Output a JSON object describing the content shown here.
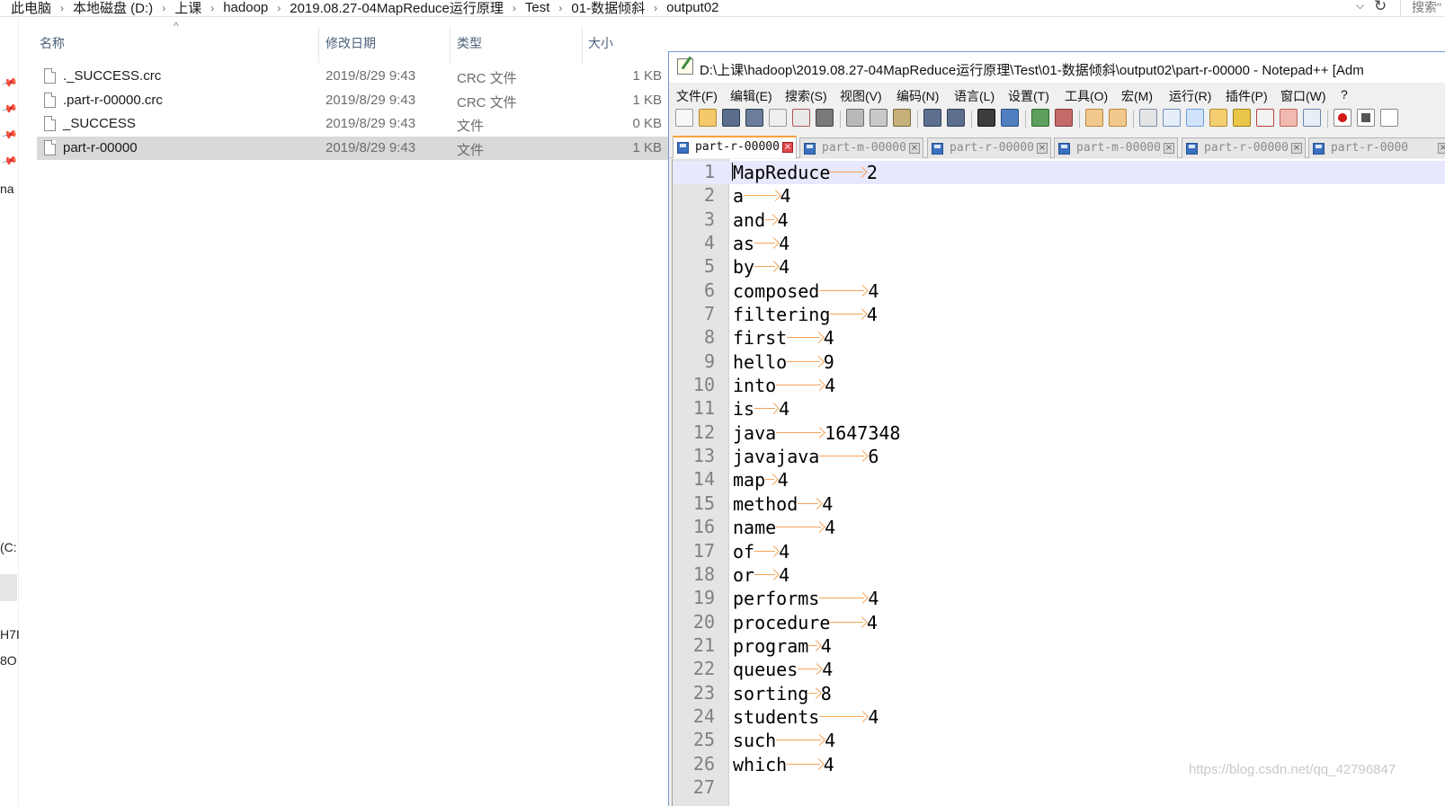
{
  "explorer": {
    "breadcrumbs": [
      "此电脑",
      "本地磁盘 (D:)",
      "上课",
      "hadoop",
      "2019.08.27-04MapReduce运行原理",
      "Test",
      "01-数据倾斜",
      "output02"
    ],
    "search_placeholder": "搜索\"",
    "nav_fragments": [
      "na",
      "(C:",
      "H7I",
      "8O"
    ],
    "columns": {
      "name": "名称",
      "date": "修改日期",
      "type": "类型",
      "size": "大小"
    },
    "files": [
      {
        "name": "._SUCCESS.crc",
        "date": "2019/8/29 9:43",
        "type": "CRC 文件",
        "size": "1 KB",
        "selected": false
      },
      {
        "name": ".part-r-00000.crc",
        "date": "2019/8/29 9:43",
        "type": "CRC 文件",
        "size": "1 KB",
        "selected": false
      },
      {
        "name": "_SUCCESS",
        "date": "2019/8/29 9:43",
        "type": "文件",
        "size": "0 KB",
        "selected": false
      },
      {
        "name": "part-r-00000",
        "date": "2019/8/29 9:43",
        "type": "文件",
        "size": "1 KB",
        "selected": true
      }
    ]
  },
  "notepad": {
    "title": "D:\\上课\\hadoop\\2019.08.27-04MapReduce运行原理\\Test\\01-数据倾斜\\output02\\part-r-00000 - Notepad++ [Adm",
    "menus": [
      "文件(F)",
      "编辑(E)",
      "搜索(S)",
      "视图(V)",
      "编码(N)",
      "语言(L)",
      "设置(T)",
      "工具(O)",
      "宏(M)",
      "运行(R)",
      "插件(P)",
      "窗口(W)",
      "?"
    ],
    "tabs": [
      {
        "label": "part-r-00000",
        "active": true
      },
      {
        "label": "part-m-00000",
        "active": false
      },
      {
        "label": "part-r-00000",
        "active": false
      },
      {
        "label": "part-m-00000",
        "active": false
      },
      {
        "label": "part-r-00000",
        "active": false
      },
      {
        "label": "part-r-0000",
        "active": false
      }
    ],
    "lines": [
      {
        "n": "1",
        "word": "MapReduce",
        "count": "2"
      },
      {
        "n": "2",
        "word": "a",
        "count": "4"
      },
      {
        "n": "3",
        "word": "and",
        "count": "4"
      },
      {
        "n": "4",
        "word": "as",
        "count": "4"
      },
      {
        "n": "5",
        "word": "by",
        "count": "4"
      },
      {
        "n": "6",
        "word": "composed",
        "count": "4"
      },
      {
        "n": "7",
        "word": "filtering",
        "count": "4"
      },
      {
        "n": "8",
        "word": "first",
        "count": "4"
      },
      {
        "n": "9",
        "word": "hello",
        "count": "9"
      },
      {
        "n": "10",
        "word": "into",
        "count": "4"
      },
      {
        "n": "11",
        "word": "is",
        "count": "4"
      },
      {
        "n": "12",
        "word": "java",
        "count": "1647348"
      },
      {
        "n": "13",
        "word": "javajava",
        "count": "6"
      },
      {
        "n": "14",
        "word": "map",
        "count": "4"
      },
      {
        "n": "15",
        "word": "method",
        "count": "4"
      },
      {
        "n": "16",
        "word": "name",
        "count": "4"
      },
      {
        "n": "17",
        "word": "of",
        "count": "4"
      },
      {
        "n": "18",
        "word": "or",
        "count": "4"
      },
      {
        "n": "19",
        "word": "performs",
        "count": "4"
      },
      {
        "n": "20",
        "word": "procedure",
        "count": "4"
      },
      {
        "n": "21",
        "word": "program",
        "count": "4"
      },
      {
        "n": "22",
        "word": "queues",
        "count": "4"
      },
      {
        "n": "23",
        "word": "sorting",
        "count": "8"
      },
      {
        "n": "24",
        "word": "students",
        "count": "4"
      },
      {
        "n": "25",
        "word": "such",
        "count": "4"
      },
      {
        "n": "26",
        "word": "which",
        "count": "4"
      },
      {
        "n": "27",
        "word": "",
        "count": ""
      }
    ]
  },
  "watermark": "https://blog.csdn.net/qq_42796847"
}
